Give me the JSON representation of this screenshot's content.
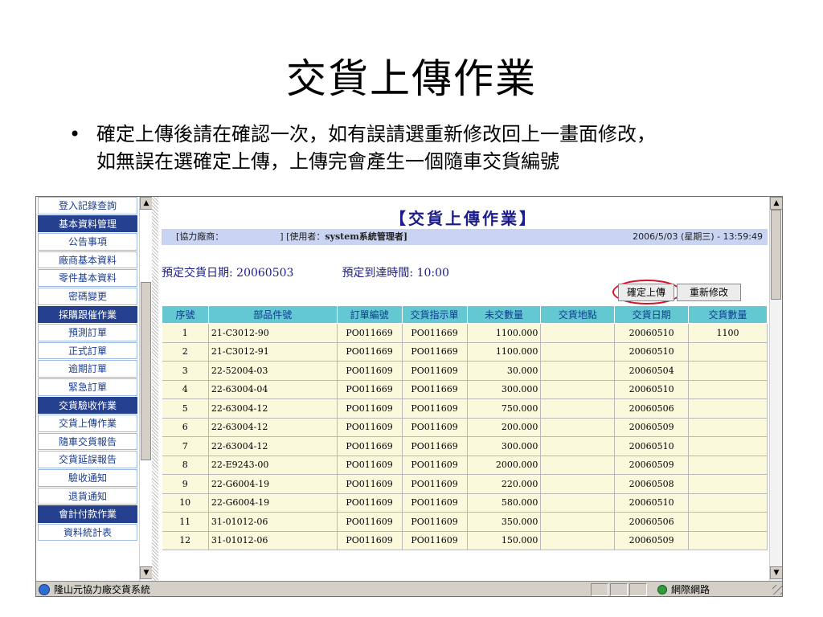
{
  "slide": {
    "title": "交貨上傳作業",
    "bullet_marker": "•",
    "bullet_line1": "確定上傳後請在確認一次，如有誤請選重新修改回上一畫面修改，",
    "bullet_line2": "如無誤在選確定上傳，上傳完會產生一個隨車交貨編號"
  },
  "nav": {
    "items": [
      {
        "label": "登入記錄查詢",
        "kind": "sub"
      },
      {
        "label": "基本資料管理",
        "kind": "head"
      },
      {
        "label": "公告事項",
        "kind": "sub"
      },
      {
        "label": "廠商基本資料",
        "kind": "sub"
      },
      {
        "label": "零件基本資料",
        "kind": "sub"
      },
      {
        "label": "密碼變更",
        "kind": "sub"
      },
      {
        "label": "採購跟催作業",
        "kind": "head"
      },
      {
        "label": "預測訂單",
        "kind": "sub"
      },
      {
        "label": "正式訂單",
        "kind": "sub"
      },
      {
        "label": "逾期訂單",
        "kind": "sub"
      },
      {
        "label": "緊急訂單",
        "kind": "sub"
      },
      {
        "label": "交貨驗收作業",
        "kind": "head"
      },
      {
        "label": "交貨上傳作業",
        "kind": "sub"
      },
      {
        "label": "隨車交貨報告",
        "kind": "sub"
      },
      {
        "label": "交貨延誤報告",
        "kind": "sub"
      },
      {
        "label": "驗收通知",
        "kind": "sub"
      },
      {
        "label": "退貨通知",
        "kind": "sub"
      },
      {
        "label": "會計付款作業",
        "kind": "head"
      },
      {
        "label": "資料統計表",
        "kind": "sub"
      }
    ]
  },
  "main": {
    "title": "【交貨上傳作業】",
    "info_left_prefix": "[協力廠商：",
    "info_left_mid": "] [使用者：",
    "info_user": "system系統管理者",
    "info_left_suffix": "]",
    "info_datetime": "2006/5/03 (星期三) - 13:59:49",
    "scheduled_date": "預定交貨日期: 20060503",
    "scheduled_time": "預定到達時間: 10:00",
    "confirm_button": "確定上傳",
    "modify_button": "重新修改",
    "columns": [
      "序號",
      "部品件號",
      "訂單編號",
      "交貨指示單",
      "未交數量",
      "交貨地點",
      "交貨日期",
      "交貨數量"
    ],
    "rows": [
      [
        "1",
        "21-C3012-90",
        "PO011669",
        "PO011669",
        "1100.000",
        "",
        "20060510",
        "1100"
      ],
      [
        "2",
        "21-C3012-91",
        "PO011669",
        "PO011669",
        "1100.000",
        "",
        "20060510",
        ""
      ],
      [
        "3",
        "22-52004-03",
        "PO011609",
        "PO011609",
        "30.000",
        "",
        "20060504",
        ""
      ],
      [
        "4",
        "22-63004-04",
        "PO011669",
        "PO011669",
        "300.000",
        "",
        "20060510",
        ""
      ],
      [
        "5",
        "22-63004-12",
        "PO011609",
        "PO011609",
        "750.000",
        "",
        "20060506",
        ""
      ],
      [
        "6",
        "22-63004-12",
        "PO011609",
        "PO011609",
        "200.000",
        "",
        "20060509",
        ""
      ],
      [
        "7",
        "22-63004-12",
        "PO011669",
        "PO011669",
        "300.000",
        "",
        "20060510",
        ""
      ],
      [
        "8",
        "22-E9243-00",
        "PO011609",
        "PO011609",
        "2000.000",
        "",
        "20060509",
        ""
      ],
      [
        "9",
        "22-G6004-19",
        "PO011609",
        "PO011609",
        "220.000",
        "",
        "20060508",
        ""
      ],
      [
        "10",
        "22-G6004-19",
        "PO011609",
        "PO011609",
        "580.000",
        "",
        "20060510",
        ""
      ],
      [
        "11",
        "31-01012-06",
        "PO011609",
        "PO011609",
        "350.000",
        "",
        "20060506",
        ""
      ],
      [
        "12",
        "31-01012-06",
        "PO011609",
        "PO011609",
        "150.000",
        "",
        "20060509",
        ""
      ]
    ]
  },
  "status": {
    "text": "隆山元協力廠交貨系統",
    "zone": "網際網路"
  }
}
